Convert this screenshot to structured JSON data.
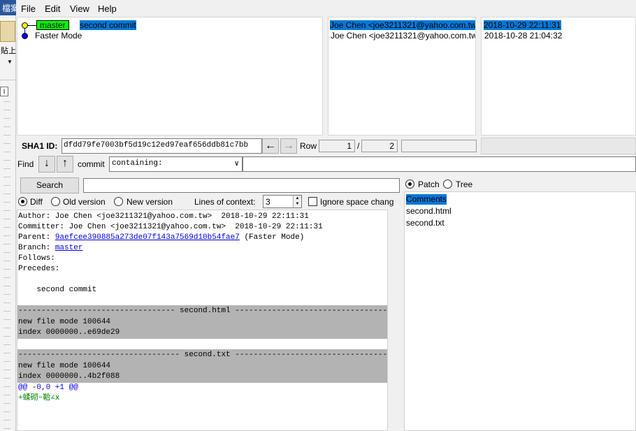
{
  "window": {
    "title_fragment": "檔案",
    "paste_label": "貼上"
  },
  "menu": [
    "File",
    "Edit",
    "View",
    "Help"
  ],
  "commits": [
    {
      "branch": "master",
      "message": "second commit",
      "author": "Joe Chen <joe3211321@yahoo.com.tw>",
      "date": "2018-10-29 22:11:31",
      "selected": true
    },
    {
      "branch": "",
      "message": "Faster Mode",
      "author": "Joe Chen <joe3211321@yahoo.com.tw>",
      "date": "2018-10-28 21:04:32",
      "selected": false
    }
  ],
  "sha": {
    "label": "SHA1 ID:",
    "value": "dfdd79fe7003bf5d19c12ed97eaf656ddb81c7bb",
    "row_label": "Row",
    "row_current": "1",
    "row_sep": "/",
    "row_total": "2"
  },
  "find": {
    "label": "Find",
    "commit_label": "commit",
    "mode": "containing:",
    "search_button": "Search"
  },
  "options": {
    "diff": "Diff",
    "old_version": "Old version",
    "new_version": "New version",
    "context_label": "Lines of context:",
    "context_value": "3",
    "ignore_space": "Ignore space chang"
  },
  "details": {
    "author": "Author: Joe Chen <joe3211321@yahoo.com.tw>  2018-10-29 22:11:31",
    "committer": "Committer: Joe Chen <joe3211321@yahoo.com.tw>  2018-10-29 22:11:31",
    "parent_label": "Parent: ",
    "parent_hash": "9aefcee390885a273de07f143a7569d10b54fae7",
    "parent_name": " (Faster Mode)",
    "branch_label": "Branch: ",
    "branch_name": "master",
    "follows": "Follows:",
    "precedes": "Precedes:",
    "message": "    second commit"
  },
  "diff": [
    {
      "header": "---------------------------------- second.html ----------------------------------",
      "mode": "new file mode 100644",
      "index": "index 0000000..e69de29"
    },
    {
      "header": "----------------------------------- second.txt -----------------------------------",
      "mode": "new file mode 100644",
      "index": "index 0000000..4b2f088"
    }
  ],
  "hunk": "@@ -0,0 +1 @@",
  "added_line": "+蝚砌▫鞈∠ⅹ",
  "view_toggle": {
    "patch": "Patch",
    "tree": "Tree"
  },
  "files": [
    "Comments",
    "second.html",
    "second.txt"
  ]
}
